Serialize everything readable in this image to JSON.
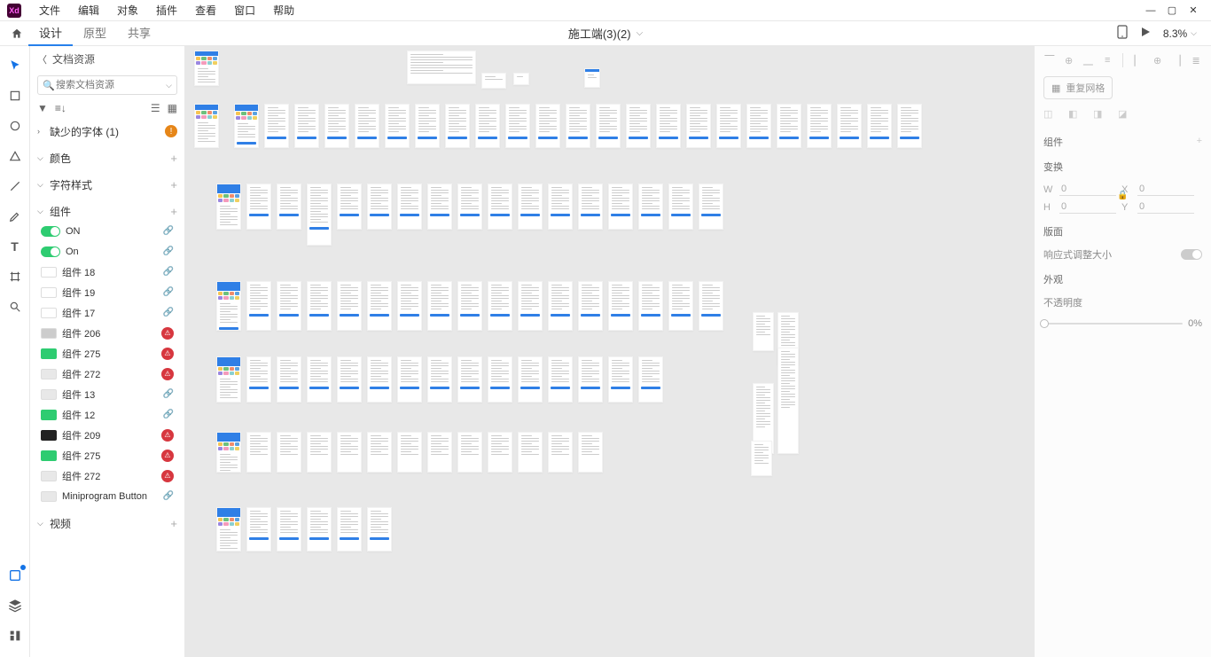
{
  "menubar": {
    "items": [
      "文件",
      "编辑",
      "对象",
      "插件",
      "查看",
      "窗口",
      "帮助"
    ]
  },
  "modebar": {
    "tabs": [
      "设计",
      "原型",
      "共享"
    ],
    "active_tab": 0,
    "doc_title": "施工端(3)(2)",
    "zoom": "8.3%"
  },
  "left_panel": {
    "header": "文档资源",
    "search_placeholder": "搜索文档资源",
    "sections": {
      "missing_fonts": {
        "label": "缺少的字体 (1)",
        "open": false,
        "warn": true
      },
      "colors": {
        "label": "颜色",
        "open": true
      },
      "char_styles": {
        "label": "字符样式",
        "open": true
      },
      "components": {
        "label": "组件",
        "open": true
      },
      "video": {
        "label": "视频",
        "open": true
      }
    },
    "components": [
      {
        "name": "ON",
        "kind": "toggle",
        "broken": false
      },
      {
        "name": "On",
        "kind": "toggle",
        "broken": false
      },
      {
        "name": "组件 18",
        "kind": "swatch-white",
        "broken": false
      },
      {
        "name": "组件 19",
        "kind": "swatch-white",
        "broken": false
      },
      {
        "name": "组件 17",
        "kind": "swatch-white",
        "broken": false
      },
      {
        "name": "组件 206",
        "kind": "swatch-gray",
        "broken": true
      },
      {
        "name": "组件 275",
        "kind": "swatch-green",
        "broken": true
      },
      {
        "name": "组件 272",
        "kind": "swatch-lgray",
        "broken": true
      },
      {
        "name": "组件 13",
        "kind": "swatch-lgray",
        "broken": false
      },
      {
        "name": "组件 12",
        "kind": "swatch-green",
        "broken": false
      },
      {
        "name": "组件 209",
        "kind": "swatch-dark",
        "broken": true
      },
      {
        "name": "组件 275",
        "kind": "swatch-green",
        "broken": true
      },
      {
        "name": "组件 272",
        "kind": "swatch-lgray",
        "broken": true
      },
      {
        "name": "Miniprogram Button",
        "kind": "swatch-lgray",
        "broken": false
      }
    ]
  },
  "right_panel": {
    "repeat_grid": "重复网格",
    "sec_component": "组件",
    "sec_transform": "变换",
    "w_label": "W",
    "w_val": "0",
    "h_label": "H",
    "h_val": "0",
    "x_label": "X",
    "x_val": "0",
    "y_label": "Y",
    "y_val": "0",
    "sec_layout": "版面",
    "responsive": "响应式调整大小",
    "sec_appearance": "外观",
    "opacity_label": "不透明度",
    "opacity_val": "0%"
  }
}
